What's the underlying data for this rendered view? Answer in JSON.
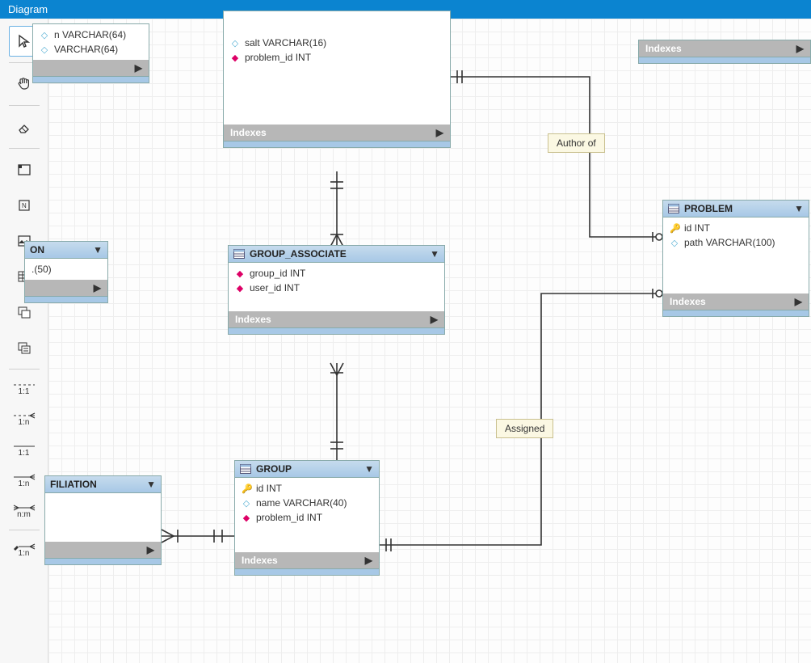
{
  "chart_data": {
    "type": "er-diagram",
    "entities": [
      {
        "name": "(partial top-left table)",
        "fields": [
          "…n VARCHAR(64)",
          "…VARCHAR(64)"
        ],
        "has_indexes_section": true,
        "partial": true
      },
      {
        "name": "…ON",
        "fields": [
          "….(50)"
        ],
        "has_indexes_section": true,
        "partial": true
      },
      {
        "name": "…FILIATION",
        "fields": [],
        "has_indexes_section": true,
        "partial": true
      },
      {
        "name": "(partial top-center table)",
        "fields": [
          "salt VARCHAR(16)",
          "problem_id INT (FK)"
        ],
        "has_indexes_section": true,
        "partial": true
      },
      {
        "name": "GROUP_ASSOCIATE",
        "fields": [
          "group_id INT (FK)",
          "user_id INT (FK)"
        ],
        "has_indexes_section": true
      },
      {
        "name": "GROUP",
        "fields": [
          "id INT (PK)",
          "name VARCHAR(40)",
          "problem_id INT (FK)"
        ],
        "has_indexes_section": true
      },
      {
        "name": "PROBLEM",
        "fields": [
          "id INT (PK)",
          "path VARCHAR(100)"
        ],
        "has_indexes_section": true
      },
      {
        "name": "(partial top-right table)",
        "fields": [],
        "has_indexes_section": true,
        "partial": true
      }
    ],
    "relationships": [
      {
        "from": "(top-center table)",
        "to": "PROBLEM",
        "label": "Author of"
      },
      {
        "from": "GROUP",
        "to": "PROBLEM",
        "label": "Assigned"
      },
      {
        "from": "(top-center table)",
        "to": "GROUP_ASSOCIATE",
        "label": null
      },
      {
        "from": "GROUP_ASSOCIATE",
        "to": "GROUP",
        "label": null
      },
      {
        "from": "…FILIATION",
        "to": "GROUP",
        "label": null
      }
    ]
  },
  "tab": {
    "label": "Diagram"
  },
  "toolbar": {
    "tools": [
      {
        "name": "select",
        "icon": "cursor",
        "selected": true
      },
      {
        "name": "pan",
        "icon": "hand"
      },
      {
        "name": "eraser",
        "icon": "eraser"
      },
      {
        "name": "layer",
        "icon": "layer"
      },
      {
        "name": "note",
        "icon": "note"
      },
      {
        "name": "image",
        "icon": "image"
      },
      {
        "name": "table",
        "icon": "table"
      },
      {
        "name": "view",
        "icon": "view"
      },
      {
        "name": "routine",
        "icon": "routine"
      }
    ],
    "rels": [
      {
        "label": "1:1",
        "style": "dash"
      },
      {
        "label": "1:n",
        "style": "crow"
      },
      {
        "label": "1:1",
        "style": "solid"
      },
      {
        "label": "1:n",
        "style": "solid-crow"
      },
      {
        "label": "n:m",
        "style": "crow-crow"
      },
      {
        "label": "1:n",
        "style": "pencil"
      }
    ]
  },
  "labels": {
    "author_of": "Author of",
    "assigned": "Assigned",
    "indexes": "Indexes"
  },
  "entities": {
    "topright": {
      "title": ""
    },
    "topleft": {
      "f1": "n VARCHAR(64)",
      "f2": "VARCHAR(64)"
    },
    "on": {
      "title": "ON",
      "f1": ".(50)"
    },
    "filiation": {
      "title": "FILIATION"
    },
    "topcenter": {
      "salt": "salt VARCHAR(16)",
      "problem_id": "problem_id INT"
    },
    "group_associate": {
      "title": "GROUP_ASSOCIATE",
      "group_id": "group_id INT",
      "user_id": "user_id INT"
    },
    "group": {
      "title": "GROUP",
      "id": "id INT",
      "name": "name VARCHAR(40)",
      "problem_id": "problem_id INT"
    },
    "problem": {
      "title": "PROBLEM",
      "id": "id INT",
      "path": "path VARCHAR(100)"
    }
  }
}
